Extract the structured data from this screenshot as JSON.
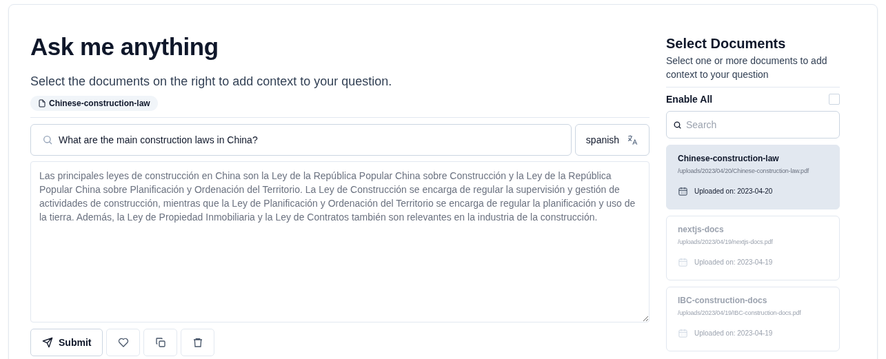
{
  "main": {
    "title": "Ask me anything",
    "subtitle": "Select the documents on the right to add context to your question.",
    "chips": [
      "Chinese-construction-law"
    ],
    "question": {
      "value": "What are the main construction laws in China?"
    },
    "language_button": "spanish",
    "answer": {
      "value": "Las principales leyes de construcción en China son la Ley de la República Popular China sobre Construcción y la Ley de la República Popular China sobre Planificación y Ordenación del Territorio. La Ley de Construcción se encarga de regular la supervisión y gestión de actividades de construcción, mientras que la Ley de Planificación y Ordenación del Territorio se encarga de regular la planificación y uso de la tierra. Además, la Ley de Propiedad Inmobiliaria y la Ley de Contratos también son relevantes en la industria de la construcción."
    },
    "actions": [
      {
        "kind": "submit",
        "label": "Submit"
      },
      {
        "kind": "like"
      },
      {
        "kind": "copy"
      },
      {
        "kind": "delete"
      }
    ]
  },
  "sidebar": {
    "title": "Select Documents",
    "description": "Select one or more documents to add context to your question",
    "enable_all": {
      "label": "Enable All",
      "checked": false
    },
    "search": {
      "placeholder": "Search"
    },
    "documents": [
      {
        "name": "Chinese-construction-law",
        "path": "/uploads/2023/04/20/Chinese-construction-law.pdf",
        "uploaded": "Uploaded on: 2023-04-20",
        "selected": true
      },
      {
        "name": "nextjs-docs",
        "path": "/uploads/2023/04/19/nextjs-docs.pdf",
        "uploaded": "Uploaded on: 2023-04-19",
        "selected": false
      },
      {
        "name": "IBC-construction-docs",
        "path": "/uploads/2023/04/19/IBC-construction-docs.pdf",
        "uploaded": "Uploaded on: 2023-04-19",
        "selected": false
      }
    ]
  }
}
